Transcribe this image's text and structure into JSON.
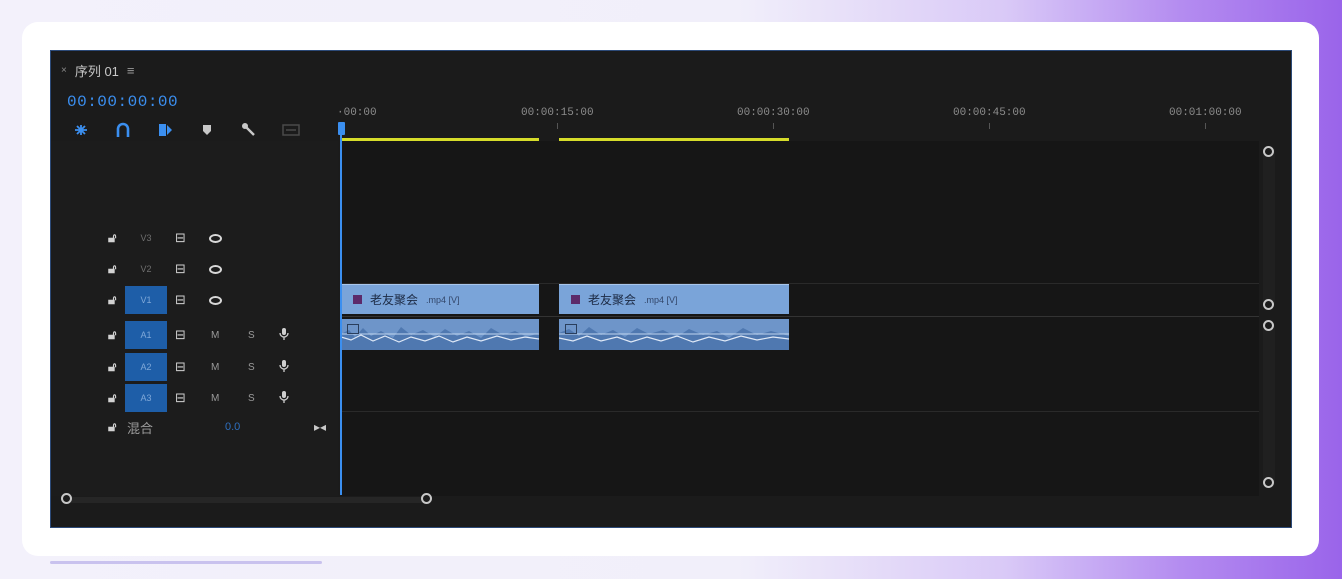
{
  "sequence": {
    "title": "序列 01",
    "close_glyph": "×",
    "menu_glyph": "≡",
    "timecode": "00:00:00:00"
  },
  "tools": [
    {
      "icon": "ripple-insert-icon",
      "glyph": "⟜"
    },
    {
      "icon": "snap-magnet-icon",
      "glyph": "∩"
    },
    {
      "icon": "linked-selection-icon",
      "glyph": "⧉"
    },
    {
      "icon": "add-marker-icon",
      "glyph": "▾"
    },
    {
      "icon": "wrench-settings-icon",
      "glyph": "🔧"
    },
    {
      "icon": "captions-icon",
      "glyph": "▭"
    }
  ],
  "ruler": {
    "labels": [
      "·00:00",
      "00:00:15:00",
      "00:00:30:00",
      "00:00:45:00",
      "00:01:00:00"
    ]
  },
  "tracks": {
    "video": [
      {
        "name": "V3",
        "active": false
      },
      {
        "name": "V2",
        "active": false
      },
      {
        "name": "V1",
        "active": true
      }
    ],
    "audio": [
      {
        "name": "A1",
        "mute": "M",
        "solo": "S"
      },
      {
        "name": "A2",
        "mute": "M",
        "solo": "S"
      },
      {
        "name": "A3",
        "mute": "M",
        "solo": "S"
      }
    ],
    "mix": {
      "label": "混合",
      "value": "0.0"
    }
  },
  "clips": [
    {
      "name": "老友聚会",
      "ext": ".mp4 [V]"
    },
    {
      "name": "老友聚会",
      "ext": ".mp4 [V]"
    }
  ],
  "colors": {
    "accent": "#3b8ff0",
    "clip_video": "#7aa4d9",
    "clip_audio": "#6e95c9",
    "work_area": "#d6dc2a",
    "track_active": "#1e5ea8"
  }
}
